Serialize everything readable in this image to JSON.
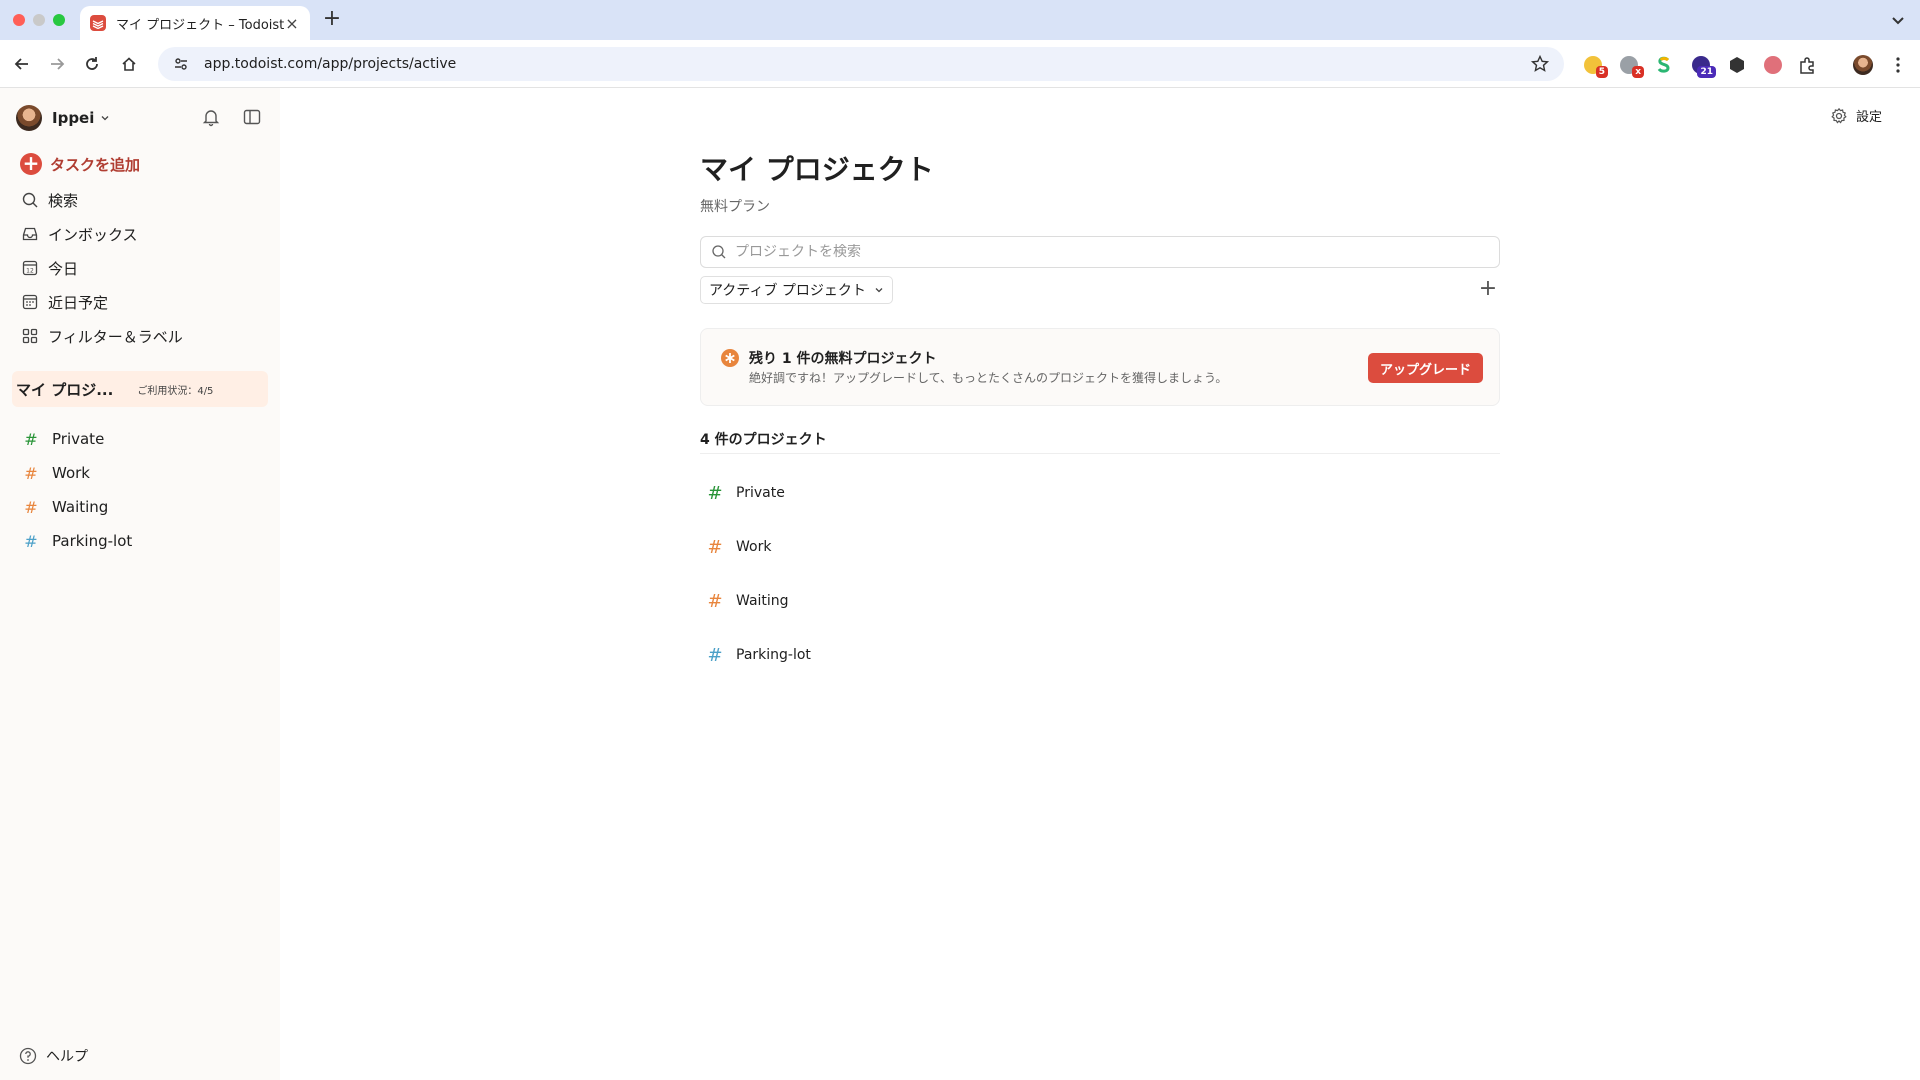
{
  "browser": {
    "tab_title": "マイ プロジェクト – Todoist",
    "url": "app.todoist.com/app/projects/active",
    "extensions": [
      {
        "name": "extension-1",
        "badge": "5",
        "badge_color": "#d93025"
      },
      {
        "name": "extension-2",
        "badge": "x",
        "badge_color": "#d93025"
      },
      {
        "name": "extension-3",
        "badge": "",
        "badge_color": ""
      },
      {
        "name": "extension-4",
        "badge": "21",
        "badge_color": "#4b2bb8"
      }
    ]
  },
  "sidebar": {
    "user": "Ippei",
    "add_task": "タスクを追加",
    "nav": [
      {
        "label": "検索",
        "icon": "search-icon"
      },
      {
        "label": "インボックス",
        "icon": "inbox-icon"
      },
      {
        "label": "今日",
        "icon": "calendar-today-icon"
      },
      {
        "label": "近日予定",
        "icon": "calendar-upcoming-icon"
      },
      {
        "label": "フィルター＆ラベル",
        "icon": "filters-labels-icon"
      }
    ],
    "my_projects": {
      "title": "マイ プロジ...",
      "usage": "ご利用状況：4/5"
    },
    "projects": [
      {
        "label": "Private",
        "color": "#299438"
      },
      {
        "label": "Work",
        "color": "#e8853d"
      },
      {
        "label": "Waiting",
        "color": "#e8853d"
      },
      {
        "label": "Parking-lot",
        "color": "#6accbc"
      }
    ],
    "help": "ヘルプ"
  },
  "main": {
    "settings": "設定",
    "title": "マイ プロジェクト",
    "plan": "無料プラン",
    "search_placeholder": "プロジェクトを検索",
    "filter": "アクティブ プロジェクト",
    "upgrade": {
      "title": "残り 1 件の無料プロジェクト",
      "description": "絶好調ですね！アップグレードして、もっとたくさんのプロジェクトを獲得しましょう。",
      "button": "アップグレード"
    },
    "count_title": "4 件のプロジェクト",
    "projects": [
      {
        "label": "Private",
        "color": "#299438"
      },
      {
        "label": "Work",
        "color": "#e8853d"
      },
      {
        "label": "Waiting",
        "color": "#e8853d"
      },
      {
        "label": "Parking-lot",
        "color": "#4ca0c8"
      }
    ]
  },
  "colors": {
    "accent": "#dc4c3e",
    "sidebar_bg": "#fcfaf8",
    "selected_bg": "#ffefe5"
  }
}
